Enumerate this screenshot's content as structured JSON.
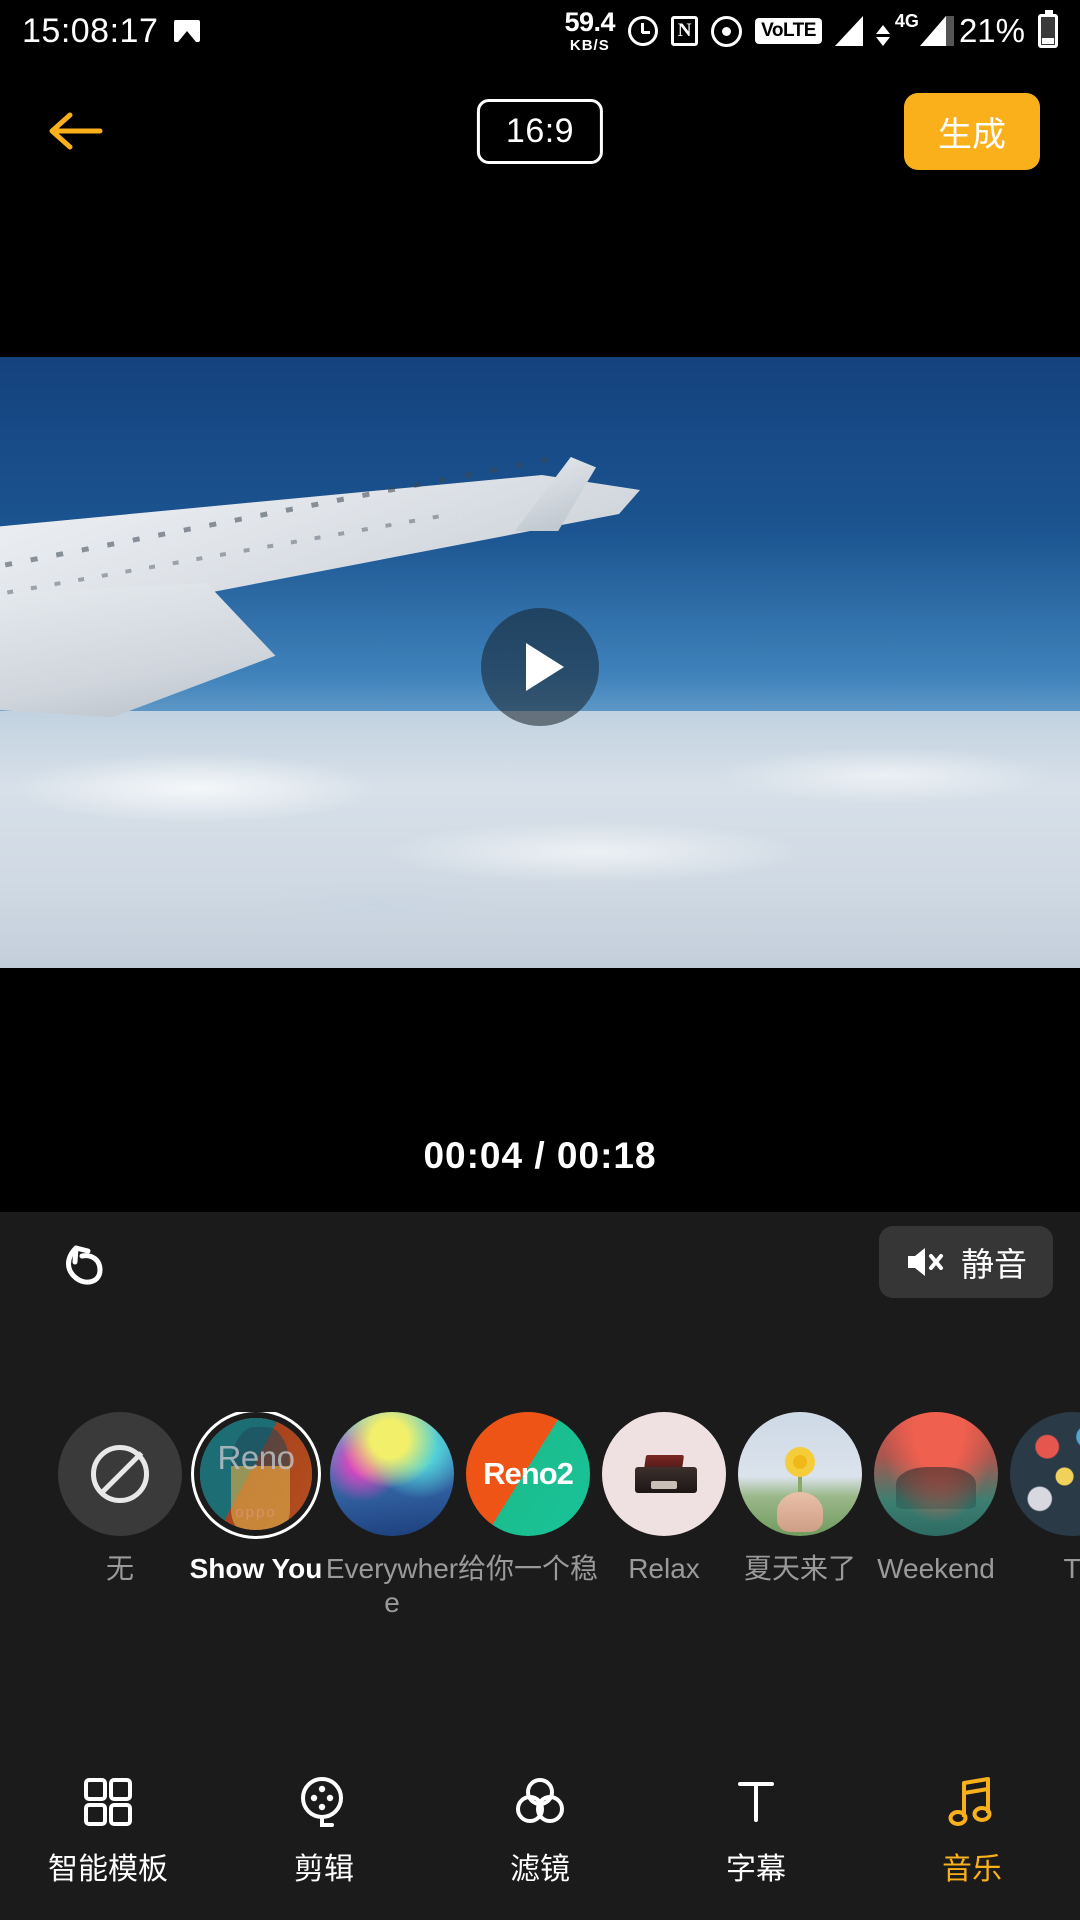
{
  "status_bar": {
    "time": "15:08:17",
    "network_speed_value": "59.4",
    "network_speed_unit": "KB/S",
    "volte_label": "VoLTE",
    "network_type": "4G",
    "battery_percent": "21%"
  },
  "toolbar": {
    "back_icon": "arrow-left-icon",
    "aspect_ratio": "16:9",
    "generate_label": "生成",
    "accent_color": "#FAB01A"
  },
  "preview": {
    "play_icon": "play-icon",
    "current_time": "00:04",
    "total_time": "00:18",
    "timestamp": "00:04 / 00:18"
  },
  "panel": {
    "undo_icon": "undo-icon",
    "mute_icon": "speaker-mute-icon",
    "mute_label": "静音"
  },
  "music": {
    "items": [
      {
        "label": "无",
        "thumb": "none",
        "selected": false
      },
      {
        "label": "Show You",
        "thumb": "reno",
        "selected": true,
        "art_text": "Reno",
        "art_sub": "oppo"
      },
      {
        "label": "Everywhere",
        "thumb": "ev",
        "selected": false
      },
      {
        "label": "给你一个稳",
        "thumb": "reno2",
        "selected": false,
        "art_text": "Reno2"
      },
      {
        "label": "Relax",
        "thumb": "relax",
        "selected": false
      },
      {
        "label": "夏天来了",
        "thumb": "summer",
        "selected": false
      },
      {
        "label": "Weekend",
        "thumb": "weekend",
        "selected": false
      },
      {
        "label": "T",
        "thumb": "conf",
        "selected": false
      }
    ]
  },
  "bottom_nav": {
    "items": [
      {
        "label": "智能模板",
        "icon": "grid-icon",
        "active": false
      },
      {
        "label": "剪辑",
        "icon": "film-reel-icon",
        "active": false
      },
      {
        "label": "滤镜",
        "icon": "filter-circles-icon",
        "active": false
      },
      {
        "label": "字幕",
        "icon": "text-t-icon",
        "active": false
      },
      {
        "label": "音乐",
        "icon": "music-note-icon",
        "active": true
      }
    ]
  }
}
